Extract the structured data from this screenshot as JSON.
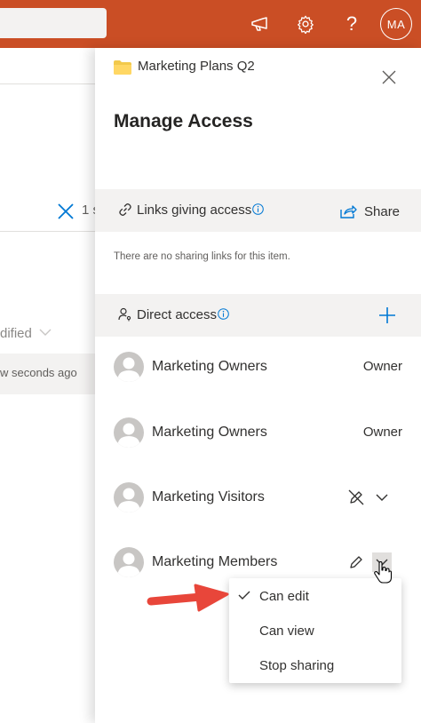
{
  "topbar": {
    "color": "#ca4e25",
    "icons": [
      "megaphone-icon",
      "gear-icon",
      "help-icon"
    ],
    "help_glyph": "?",
    "user_initials": "MA"
  },
  "background": {
    "selected_count_fragment": "1 s",
    "modified_header_fragment": "dified",
    "row_modified_fragment": "w seconds ago"
  },
  "panel": {
    "item_name": "Marketing Plans Q2",
    "title": "Manage Access",
    "links_section": {
      "label": "Links giving access",
      "share_label": "Share",
      "empty_text": "There are no sharing links for this item."
    },
    "direct_section": {
      "label": "Direct access"
    },
    "access_list": [
      {
        "name": "Marketing Owners",
        "role": "Owner"
      },
      {
        "name": "Marketing Owners",
        "role": "Owner"
      },
      {
        "name": "Marketing Visitors",
        "role_icon": "no-edit-pencil-icon"
      },
      {
        "name": "Marketing Members",
        "role_icon": "pencil-icon"
      }
    ]
  },
  "permission_menu": {
    "items": [
      {
        "label": "Can edit",
        "checked": true
      },
      {
        "label": "Can view",
        "checked": false
      },
      {
        "label": "Stop sharing",
        "checked": false
      }
    ]
  },
  "colors": {
    "accent": "#0078d4",
    "arrow": "#e8463a",
    "folder": "#f2c94c"
  }
}
